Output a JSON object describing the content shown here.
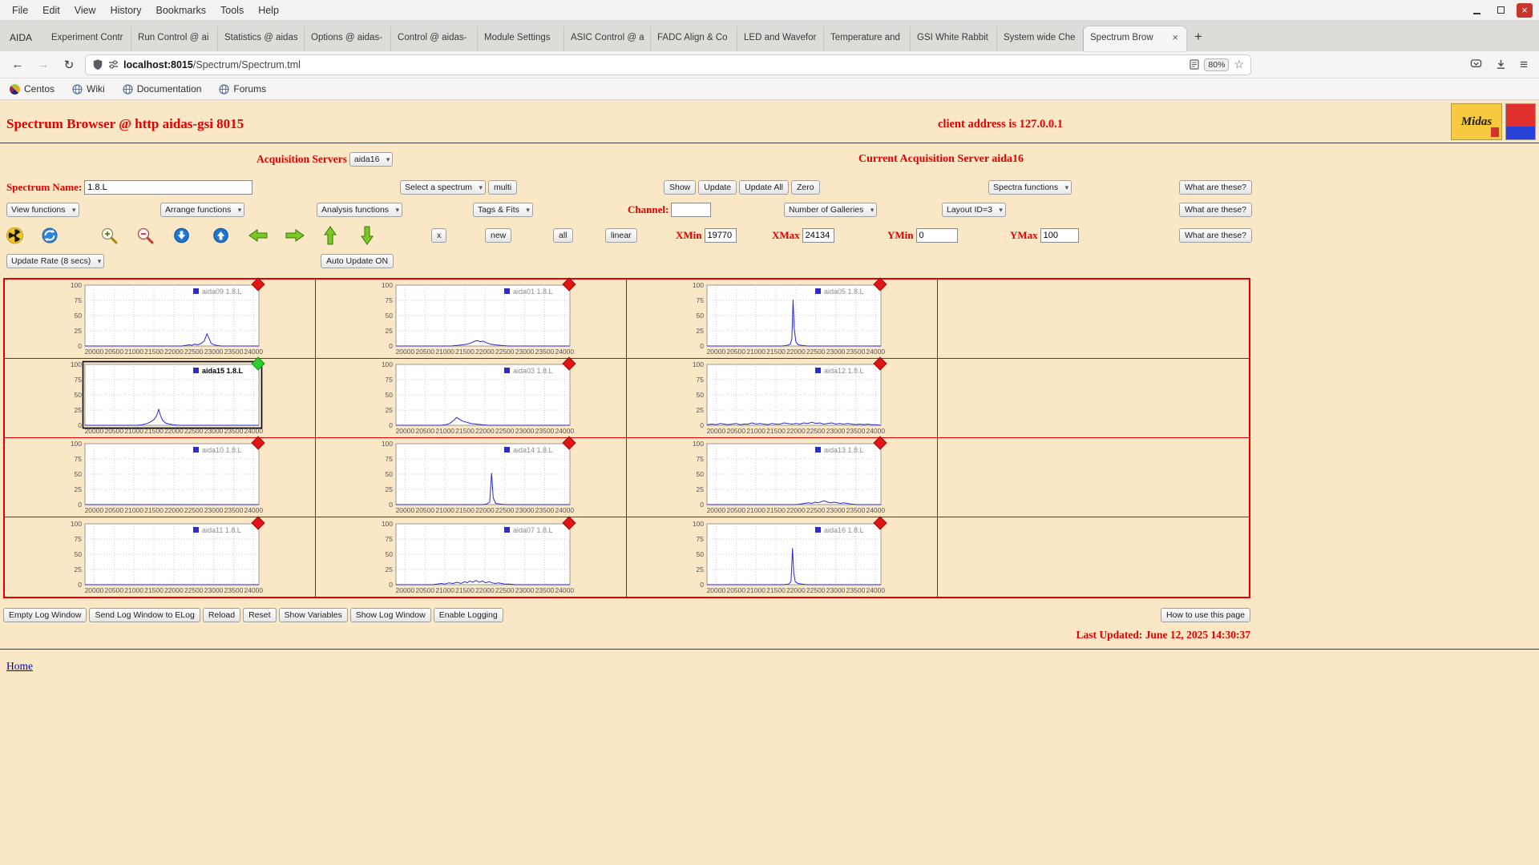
{
  "browser": {
    "menu_items": [
      "File",
      "Edit",
      "View",
      "History",
      "Bookmarks",
      "Tools",
      "Help"
    ],
    "app_label": "AIDA",
    "tabs": [
      "Experiment Contr",
      "Run Control @ ai",
      "Statistics @ aidas",
      "Options @ aidas-",
      "Control @ aidas-",
      "Module Settings",
      "ASIC Control @ a",
      "FADC Align & Co",
      "LED and Wavefor",
      "Temperature and",
      "GSI White Rabbit",
      "System wide Che"
    ],
    "active_tab": "Spectrum Brow",
    "url_host": "localhost:8015",
    "url_path": "/Spectrum/Spectrum.tml",
    "zoom_badge": "80%",
    "bookmarks": [
      "Centos",
      "Wiki",
      "Documentation",
      "Forums"
    ],
    "icons": {
      "back": "←",
      "forward": "→",
      "reload": "↻",
      "star": "☆",
      "new_tab": "+",
      "close": "×",
      "window_close": "×",
      "menu": "≡"
    }
  },
  "page": {
    "title": "Spectrum Browser @ http aidas-gsi 8015",
    "client_address": "client address is 127.0.0.1",
    "logos": {
      "midas": "Midas"
    },
    "acq_servers_label": "Acquisition Servers",
    "acq_server_value": "aida16",
    "current_server_text": "Current Acquisition Server aida16",
    "spectrum_name_label": "Spectrum Name:",
    "spectrum_name_value": "1.8.L",
    "select_spectrum_value": "Select a spectrum",
    "multi_label": "multi",
    "show_label": "Show",
    "update_label": "Update",
    "update_all_label": "Update All",
    "zero_label": "Zero",
    "spectra_functions_value": "Spectra functions",
    "what_are_these_label": "What are these?",
    "view_functions_value": "View functions",
    "arrange_functions_value": "Arrange functions",
    "analysis_functions_value": "Analysis functions",
    "tags_fits_value": "Tags & Fits",
    "channel_label": "Channel:",
    "channel_value": "",
    "num_galleries_value": "Number of Galleries",
    "layout_id_value": "Layout ID=3",
    "icon_toolbar": [
      "radiation",
      "redraw",
      "zoom-in",
      "zoom-out",
      "scroll-down",
      "scroll-up",
      "move-left",
      "move-right",
      "move-up",
      "move-down"
    ],
    "x_label": "x",
    "new_label": "new",
    "all_label": "all",
    "linear_label": "linear",
    "xmin_label": "XMin",
    "xmin_value": "19770",
    "xmax_label": "XMax",
    "xmax_value": "24134",
    "ymin_label": "YMin",
    "ymin_value": "0",
    "ymax_label": "YMax",
    "ymax_value": "100",
    "update_rate_value": "Update Rate (8 secs)",
    "auto_update_label": "Auto Update ON",
    "footer_buttons": [
      "Empty Log Window",
      "Send Log Window to ELog",
      "Reload",
      "Reset",
      "Show Variables",
      "Show Log Window",
      "Enable Logging"
    ],
    "how_to_label": "How to use this page",
    "last_updated": "Last Updated: June 12, 2025 14:30:37",
    "home_label": "Home"
  },
  "chart_data": {
    "type": "line",
    "xlim": [
      19770,
      24134
    ],
    "ylim": [
      0,
      100
    ],
    "xticks": [
      20000,
      20500,
      21000,
      21500,
      22000,
      22500,
      23000,
      23500,
      24000
    ],
    "yticks": [
      0,
      25,
      50,
      75,
      100
    ],
    "line_color": "#2b2bd0",
    "grid": true,
    "legend_position": "top-right",
    "layout": {
      "rows": 4,
      "cols": 4
    },
    "status_colors": {
      "red": [
        "#e41414",
        "#9a0a0a"
      ],
      "green": [
        "#2fd032",
        "#0f8a14"
      ]
    },
    "charts": [
      {
        "name": "aida09 1.8.L",
        "row": 0,
        "col": 0,
        "status": "red",
        "selected": false,
        "points": [
          [
            19770,
            0
          ],
          [
            22200,
            0
          ],
          [
            22300,
            1
          ],
          [
            22380,
            2
          ],
          [
            22450,
            1
          ],
          [
            22520,
            3
          ],
          [
            22600,
            2
          ],
          [
            22680,
            4
          ],
          [
            22760,
            8
          ],
          [
            22830,
            20
          ],
          [
            22880,
            13
          ],
          [
            22930,
            5
          ],
          [
            23000,
            2
          ],
          [
            23080,
            1
          ],
          [
            23180,
            0
          ],
          [
            24134,
            0
          ]
        ]
      },
      {
        "name": "aida01 1.8.L",
        "row": 0,
        "col": 1,
        "status": "red",
        "selected": false,
        "points": [
          [
            19770,
            0
          ],
          [
            21150,
            0
          ],
          [
            21300,
            1
          ],
          [
            21450,
            2
          ],
          [
            21550,
            3
          ],
          [
            21650,
            5
          ],
          [
            21750,
            8
          ],
          [
            21820,
            9
          ],
          [
            21880,
            7
          ],
          [
            21950,
            8
          ],
          [
            22050,
            5
          ],
          [
            22150,
            3
          ],
          [
            22250,
            2
          ],
          [
            22400,
            1
          ],
          [
            22600,
            0
          ],
          [
            24134,
            0
          ]
        ]
      },
      {
        "name": "aida05 1.8.L",
        "row": 0,
        "col": 2,
        "status": "red",
        "selected": false,
        "points": [
          [
            19770,
            0
          ],
          [
            21650,
            0
          ],
          [
            21780,
            1
          ],
          [
            21860,
            3
          ],
          [
            21900,
            12
          ],
          [
            21930,
            76
          ],
          [
            21960,
            28
          ],
          [
            22000,
            7
          ],
          [
            22060,
            2
          ],
          [
            22160,
            1
          ],
          [
            22300,
            0
          ],
          [
            24134,
            0
          ]
        ]
      },
      {
        "name": "aida15 1.8.L",
        "row": 1,
        "col": 0,
        "status": "green",
        "selected": true,
        "points": [
          [
            19770,
            0
          ],
          [
            21100,
            0
          ],
          [
            21220,
            1
          ],
          [
            21330,
            3
          ],
          [
            21430,
            6
          ],
          [
            21510,
            10
          ],
          [
            21570,
            16
          ],
          [
            21620,
            26
          ],
          [
            21670,
            15
          ],
          [
            21720,
            8
          ],
          [
            21790,
            4
          ],
          [
            21880,
            2
          ],
          [
            21980,
            1
          ],
          [
            22100,
            0
          ],
          [
            24134,
            0
          ]
        ]
      },
      {
        "name": "aida03 1.8.L",
        "row": 1,
        "col": 1,
        "status": "red",
        "selected": false,
        "points": [
          [
            19770,
            0
          ],
          [
            20900,
            0
          ],
          [
            21020,
            1
          ],
          [
            21120,
            3
          ],
          [
            21220,
            8
          ],
          [
            21290,
            13
          ],
          [
            21360,
            10
          ],
          [
            21440,
            7
          ],
          [
            21540,
            5
          ],
          [
            21650,
            3
          ],
          [
            21770,
            2
          ],
          [
            21920,
            1
          ],
          [
            22080,
            0
          ],
          [
            24134,
            0
          ]
        ]
      },
      {
        "name": "aida12 1.8.L",
        "row": 1,
        "col": 2,
        "status": "red",
        "selected": false,
        "points": [
          [
            19770,
            1
          ],
          [
            19900,
            2
          ],
          [
            20000,
            1
          ],
          [
            20100,
            3
          ],
          [
            20200,
            2
          ],
          [
            20300,
            1
          ],
          [
            20400,
            2
          ],
          [
            20500,
            3
          ],
          [
            20600,
            1
          ],
          [
            20700,
            2
          ],
          [
            20800,
            2
          ],
          [
            20900,
            4
          ],
          [
            21000,
            2
          ],
          [
            21100,
            3
          ],
          [
            21200,
            2
          ],
          [
            21300,
            1
          ],
          [
            21400,
            3
          ],
          [
            21500,
            2
          ],
          [
            21600,
            2
          ],
          [
            21700,
            4
          ],
          [
            21800,
            3
          ],
          [
            21900,
            2
          ],
          [
            22000,
            3
          ],
          [
            22100,
            2
          ],
          [
            22200,
            4
          ],
          [
            22300,
            3
          ],
          [
            22400,
            5
          ],
          [
            22500,
            3
          ],
          [
            22600,
            4
          ],
          [
            22700,
            2
          ],
          [
            22800,
            3
          ],
          [
            22900,
            4
          ],
          [
            23000,
            2
          ],
          [
            23100,
            3
          ],
          [
            23200,
            2
          ],
          [
            23300,
            3
          ],
          [
            23400,
            2
          ],
          [
            23500,
            1
          ],
          [
            23600,
            2
          ],
          [
            23700,
            1
          ],
          [
            23800,
            2
          ],
          [
            23900,
            1
          ],
          [
            24000,
            1
          ],
          [
            24134,
            0
          ]
        ]
      },
      {
        "name": "aida10 1.8.L",
        "row": 2,
        "col": 0,
        "status": "red",
        "selected": false,
        "points": [
          [
            19770,
            0
          ],
          [
            24134,
            0
          ]
        ]
      },
      {
        "name": "aida14 1.8.L",
        "row": 2,
        "col": 1,
        "status": "red",
        "selected": false,
        "points": [
          [
            19770,
            0
          ],
          [
            21950,
            0
          ],
          [
            22050,
            1
          ],
          [
            22120,
            4
          ],
          [
            22170,
            52
          ],
          [
            22210,
            11
          ],
          [
            22270,
            2
          ],
          [
            22370,
            1
          ],
          [
            22500,
            0
          ],
          [
            24134,
            0
          ]
        ]
      },
      {
        "name": "aida13 1.8.L",
        "row": 2,
        "col": 2,
        "status": "red",
        "selected": false,
        "points": [
          [
            19770,
            0
          ],
          [
            22000,
            0
          ],
          [
            22120,
            1
          ],
          [
            22220,
            2
          ],
          [
            22320,
            3
          ],
          [
            22400,
            2
          ],
          [
            22480,
            4
          ],
          [
            22560,
            3
          ],
          [
            22640,
            5
          ],
          [
            22720,
            6
          ],
          [
            22800,
            4
          ],
          [
            22880,
            3
          ],
          [
            22960,
            4
          ],
          [
            23040,
            3
          ],
          [
            23120,
            2
          ],
          [
            23200,
            3
          ],
          [
            23280,
            2
          ],
          [
            23380,
            1
          ],
          [
            23520,
            0
          ],
          [
            24134,
            0
          ]
        ]
      },
      {
        "name": "aida11 1.8.L",
        "row": 3,
        "col": 0,
        "status": "red",
        "selected": false,
        "points": [
          [
            19770,
            0
          ],
          [
            24134,
            0
          ]
        ]
      },
      {
        "name": "aida07 1.8.L",
        "row": 3,
        "col": 1,
        "status": "red",
        "selected": false,
        "points": [
          [
            19770,
            0
          ],
          [
            20700,
            0
          ],
          [
            20800,
            1
          ],
          [
            20900,
            2
          ],
          [
            21000,
            1
          ],
          [
            21100,
            3
          ],
          [
            21200,
            2
          ],
          [
            21300,
            4
          ],
          [
            21400,
            2
          ],
          [
            21500,
            5
          ],
          [
            21560,
            3
          ],
          [
            21620,
            6
          ],
          [
            21700,
            4
          ],
          [
            21780,
            7
          ],
          [
            21860,
            4
          ],
          [
            21940,
            6
          ],
          [
            22020,
            3
          ],
          [
            22100,
            5
          ],
          [
            22180,
            3
          ],
          [
            22260,
            2
          ],
          [
            22340,
            3
          ],
          [
            22420,
            2
          ],
          [
            22500,
            1
          ],
          [
            22620,
            1
          ],
          [
            22760,
            0
          ],
          [
            24134,
            0
          ]
        ]
      },
      {
        "name": "aida16 1.8.L",
        "row": 3,
        "col": 2,
        "status": "red",
        "selected": false,
        "points": [
          [
            19770,
            0
          ],
          [
            21700,
            0
          ],
          [
            21820,
            1
          ],
          [
            21880,
            5
          ],
          [
            21915,
            60
          ],
          [
            21945,
            20
          ],
          [
            21985,
            5
          ],
          [
            22050,
            2
          ],
          [
            22150,
            1
          ],
          [
            22280,
            0
          ],
          [
            24134,
            0
          ]
        ]
      }
    ]
  }
}
